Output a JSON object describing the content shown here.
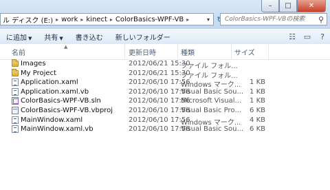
{
  "address": {
    "crumbs": [
      "ル ディスク (E:)",
      "work",
      "kinect",
      "ColorBasics-WPF-VB"
    ],
    "refresh_icon": "refresh-icon"
  },
  "search": {
    "placeholder": "ColorBasics-WPF-VBの検索",
    "icon": "search-icon"
  },
  "window_buttons": {
    "minimize": "–",
    "maximize": "□",
    "close": "✕"
  },
  "toolbar": {
    "add_label": "に追加",
    "share_label": "共有",
    "burn_label": "書き込む",
    "new_folder_label": "新しいフォルダー"
  },
  "columns": {
    "name": "名前",
    "date": "更新日時",
    "type": "種類",
    "size": "サイズ"
  },
  "files": [
    {
      "name": "Images",
      "date": "2012/06/21 15:30",
      "type": "ファイル フォル...",
      "size": "",
      "icon": "folder"
    },
    {
      "name": "My Project",
      "date": "2012/06/21 15:30",
      "type": "ファイル フォル...",
      "size": "",
      "icon": "folder"
    },
    {
      "name": "Application.xaml",
      "date": "2012/06/10 17:56",
      "type": "Windows マーク...",
      "size": "1 KB",
      "icon": "doc"
    },
    {
      "name": "Application.xaml.vb",
      "date": "2012/06/10 17:56",
      "type": "Visual Basic Sou...",
      "size": "1 KB",
      "icon": "doc"
    },
    {
      "name": "ColorBasics-WPF-VB.sln",
      "date": "2012/06/10 17:56",
      "type": "Microsoft Visual...",
      "size": "1 KB",
      "icon": "sln"
    },
    {
      "name": "ColorBasics-WPF-VB.vbproj",
      "date": "2012/06/10 17:56",
      "type": "Visual Basic Pro...",
      "size": "6 KB",
      "icon": "proj"
    },
    {
      "name": "MainWindow.xaml",
      "date": "2012/06/10 17:56",
      "type": "Windows マーク...",
      "size": "4 KB",
      "icon": "doc"
    },
    {
      "name": "MainWindow.xaml.vb",
      "date": "2012/06/10 17:56",
      "type": "Visual Basic Sou...",
      "size": "6 KB",
      "icon": "doc"
    }
  ]
}
